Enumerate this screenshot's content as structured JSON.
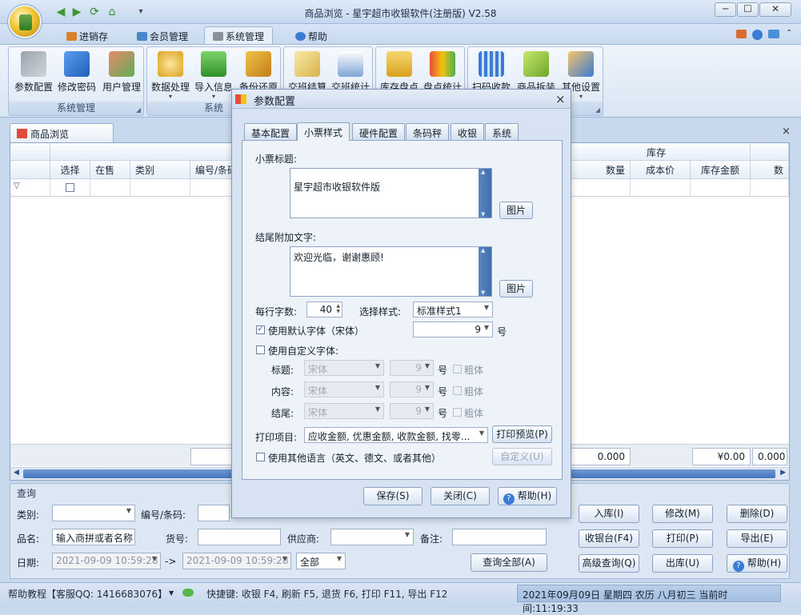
{
  "window": {
    "title": "商品浏览 - 星宇超市收银软件(注册版) V2.58",
    "min": "─",
    "max": "☐",
    "close": "✕"
  },
  "ribbon_tabs": [
    {
      "label": "进销存"
    },
    {
      "label": "会员管理"
    },
    {
      "label": "系统管理"
    },
    {
      "label": "帮助"
    }
  ],
  "ribbon": {
    "groups": [
      {
        "label": "系统管理",
        "buttons": [
          "参数配置",
          "修改密码",
          "用户管理"
        ]
      },
      {
        "label": "系统",
        "buttons": [
          "数据处理",
          "导入信息",
          "备份还原"
        ]
      },
      {
        "label": "",
        "buttons": [
          "交班结算",
          "交班统计"
        ]
      },
      {
        "label": "",
        "buttons": [
          "库存盘点",
          "盘点统计"
        ]
      },
      {
        "label": "",
        "buttons": [
          "扫码收款",
          "商品拆装",
          "其他设置"
        ]
      }
    ]
  },
  "doc_tab": {
    "label": "商品浏览",
    "close": "×"
  },
  "grid": {
    "group_header": "库存",
    "columns_left": [
      "选择",
      "在售",
      "类别",
      "编号/条码"
    ],
    "columns_right": [
      "数量",
      "成本价",
      "库存金额",
      "数"
    ],
    "sums": {
      "qty": "0.000",
      "amount": "¥0.00",
      "other": "0.000"
    }
  },
  "query": {
    "title": "查询",
    "labels": {
      "category": "类别:",
      "code": "编号/条码:",
      "name": "品名:",
      "item_no": "货号:",
      "supplier": "供应商:",
      "remark": "备注:",
      "date": "日期:",
      "arrow": "->"
    },
    "name_placeholder": "输入商拼或者名称",
    "date_from": "2021-09-09 10:59:28",
    "date_to": "2021-09-09 10:59:28",
    "date_scope": "全部",
    "buttons": {
      "query_all": "查询全部(A)",
      "stock_in": "入库(I)",
      "modify": "修改(M)",
      "delete": "删除(D)",
      "cashier": "收银台(F4)",
      "print": "打印(P)",
      "export": "导出(E)",
      "advanced": "高级查询(Q)",
      "stock_out": "出库(U)",
      "help": "帮助(H)"
    }
  },
  "status": {
    "help": "帮助教程【客服QQ: 1416683076】",
    "shortcuts": "快捷键: 收银 F4, 刷新 F5, 退货 F6, 打印 F11, 导出 F12",
    "datetime": "2021年09月09日 星期四 农历 八月初三 当前时间:11:19:33"
  },
  "dialog": {
    "title": "参数配置",
    "tabs": [
      "基本配置",
      "小票样式",
      "硬件配置",
      "条码秤",
      "收银",
      "系统"
    ],
    "receipt_title_label": "小票标题:",
    "receipt_title_value": "星宇超市收银软件版",
    "footer_label": "结尾附加文字:",
    "footer_value": "欢迎光临，谢谢惠顾!",
    "image_button": "图片",
    "chars_per_line_label": "每行字数:",
    "chars_per_line": "40",
    "style_label": "选择样式:",
    "style_value": "标准样式1",
    "use_default_font": "使用默认字体（宋体）",
    "default_font_size": "9",
    "size_unit": "号",
    "use_custom_font": "使用自定义字体:",
    "font_rows": [
      {
        "label": "标题:",
        "font": "宋体",
        "size": "9",
        "bold": "粗体"
      },
      {
        "label": "内容:",
        "font": "宋体",
        "size": "9",
        "bold": "粗体"
      },
      {
        "label": "结尾:",
        "font": "宋体",
        "size": "9",
        "bold": "粗体"
      }
    ],
    "print_items_label": "打印项目:",
    "print_items_value": "应收金额, 优惠金额, 收款金额, 找零...",
    "print_preview": "打印预览(P)",
    "other_language": "使用其他语言（英文、德文、或者其他）",
    "customize": "自定义(U)",
    "save": "保存(S)",
    "close": "关闭(C)",
    "help": "帮助(H)"
  }
}
